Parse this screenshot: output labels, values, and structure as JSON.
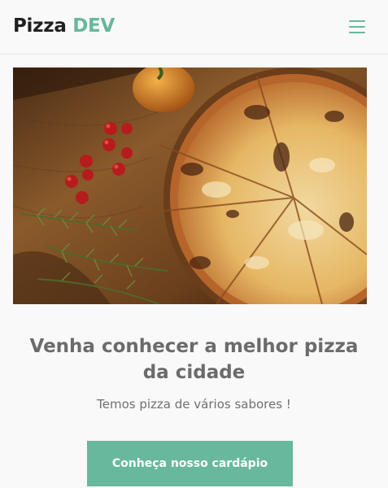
{
  "header": {
    "logo_part1": "Pizza",
    "logo_part2": "DEV",
    "menu_icon": "hamburger-menu-icon"
  },
  "hero": {
    "image": "pizza-on-wooden-board-with-tomatoes-and-rosemary"
  },
  "main": {
    "headline": "Venha conhecer a melhor pizza da cidade",
    "subtitle": "Temos pizza de vários sabores !",
    "cta_label": "Conheça nosso cardápio"
  },
  "colors": {
    "accent": "#67b89d",
    "background": "#f9f9f9",
    "text_dark": "#1f1f1f",
    "text_muted": "#6b6b6b"
  }
}
